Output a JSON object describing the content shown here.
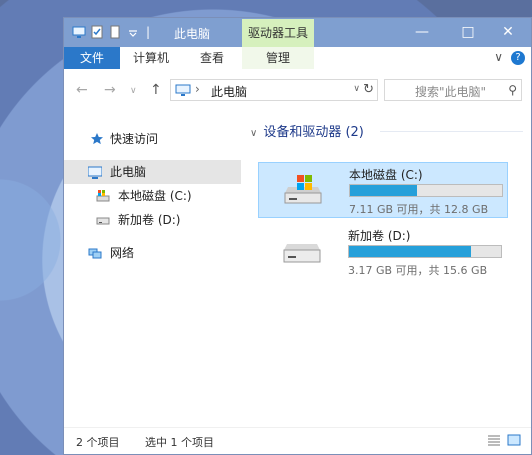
{
  "window": {
    "title": "此电脑",
    "context_tab": "驱动器工具",
    "controls": [
      "minimize",
      "maximize",
      "close"
    ]
  },
  "ribbon": {
    "tabs": [
      "文件",
      "计算机",
      "查看",
      "管理"
    ]
  },
  "address": {
    "path": "此电脑",
    "search_placeholder": "搜索\"此电脑\""
  },
  "nav": {
    "items": [
      {
        "label": "快速访问",
        "icon": "star-icon"
      },
      {
        "label": "此电脑",
        "icon": "computer-icon",
        "selected": true
      },
      {
        "label": "本地磁盘 (C:)",
        "icon": "system-drive-icon"
      },
      {
        "label": "新加卷 (D:)",
        "icon": "drive-icon"
      },
      {
        "label": "网络",
        "icon": "network-icon"
      }
    ]
  },
  "content": {
    "group_title": "设备和驱动器 (2)",
    "drives": [
      {
        "name": "本地磁盘 (C:)",
        "info": "7.11 GB 可用，共 12.8 GB",
        "used_fraction": 0.44,
        "selected": true
      },
      {
        "name": "新加卷 (D:)",
        "info": "3.17 GB 可用，共 15.6 GB",
        "used_fraction": 0.8,
        "selected": false
      }
    ]
  },
  "status": {
    "count": "2 个项目",
    "selection": "选中 1 个项目"
  },
  "colors": {
    "accent": "#2b78c9",
    "titlebar": "#7f9fd0",
    "context_tab": "#d6f0bd",
    "selection": "#cce8ff",
    "usage_bar": "#26a0da"
  }
}
